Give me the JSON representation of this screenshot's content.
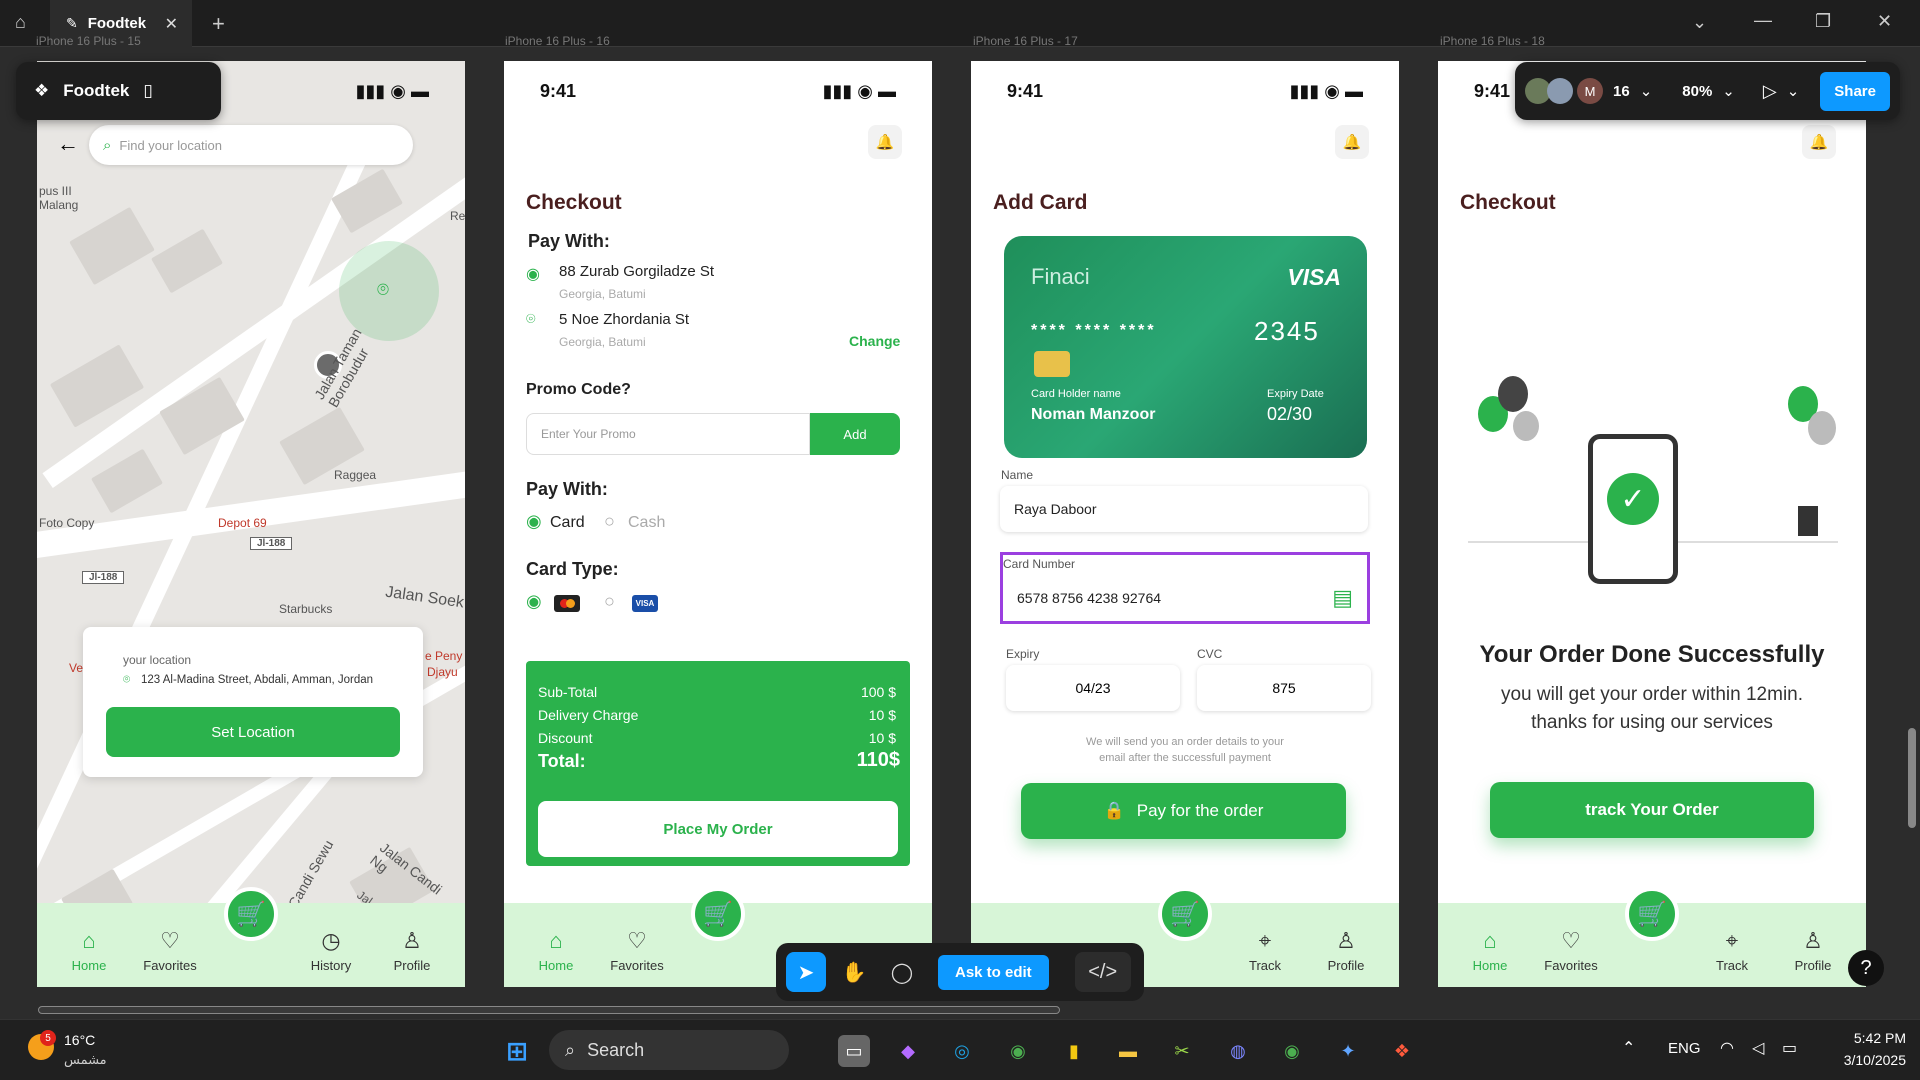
{
  "app": {
    "tab_title": "Foodtek",
    "file_name": "Foodtek"
  },
  "toolbar": {
    "zoom": "80%",
    "collaborators_count": "16",
    "avatar_letter": "M",
    "share_label": "Share",
    "ask_to_edit": "Ask to edit"
  },
  "frame_labels": [
    "iPhone 16 Plus - 15",
    "iPhone 16 Plus - 16",
    "iPhone 16 Plus - 17",
    "iPhone 16 Plus - 18"
  ],
  "status_time": "9:41",
  "nav": {
    "home": "Home",
    "favorites": "Favorites",
    "history": "History",
    "profile": "Profile",
    "track": "Track"
  },
  "screen1": {
    "search_placeholder": "Find your location",
    "map_labels": [
      "pus III Malang",
      "Re",
      "Raggea",
      "Depot 69",
      "Foto Copy",
      "Jl-188",
      "Jl-188",
      "Starbucks",
      "Jalan Soek",
      "Jalan Taman Borobudur",
      "Jalan Candi Sewu",
      "Jalan Candi Ng",
      "e Peny",
      "Djayu",
      "Ve",
      "Jal"
    ],
    "your_location_label": "your location",
    "address": "123 Al-Madina Street, Abdali, Amman, Jordan",
    "set_location": "Set Location"
  },
  "screen2": {
    "title": "Checkout",
    "pay_with": "Pay With:",
    "addresses": [
      {
        "street": "88 Zurab Gorgiladze St",
        "city": "Georgia, Batumi"
      },
      {
        "street": "5 Noe Zhordania St",
        "city": "Georgia, Batumi"
      }
    ],
    "change": "Change",
    "promo_label": "Promo Code?",
    "promo_placeholder": "Enter Your Promo",
    "add": "Add",
    "pay_with2": "Pay With:",
    "card": "Card",
    "cash": "Cash",
    "card_type": "Card Type:",
    "visa_badge": "VISA",
    "summary": [
      {
        "label": "Sub-Total",
        "value": "100 $"
      },
      {
        "label": "Delivery Charge",
        "value": "10 $"
      },
      {
        "label": "Discount",
        "value": "10 $"
      }
    ],
    "total_label": "Total:",
    "total_value": "110$",
    "place_order": "Place My Order"
  },
  "screen3": {
    "title": "Add Card",
    "card_brand": "Finaci",
    "card_network": "VISA",
    "card_masked": "**** **** ****",
    "card_last": "2345",
    "holder_label": "Card Holder name",
    "holder_name": "Noman Manzoor",
    "expiry_label": "Expiry Date",
    "expiry_value": "02/30",
    "name_label": "Name",
    "name_value": "Raya Daboor",
    "cardnum_label": "Card Number",
    "cardnum_value": "6578 8756 4238 92764",
    "exp_label": "Expiry",
    "exp_value": "04/23",
    "cvc_label": "CVC",
    "cvc_value": "875",
    "note": "We will send you an order details to your email after the successfull payment",
    "pay_button": "Pay for the order"
  },
  "screen4": {
    "title": "Checkout",
    "success_title": "Your Order Done Successfully",
    "success_msg": "you will get your order within 12min. thanks for using our services",
    "track_button": "track Your Order"
  },
  "taskbar": {
    "weather_temp": "16°C",
    "weather_desc": "مشمس",
    "weather_badge": "5",
    "search": "Search",
    "lang": "ENG",
    "time": "5:42 PM",
    "date": "3/10/2025"
  },
  "colors": {
    "brand_green": "#2bb24c",
    "figma_blue": "#0d99ff",
    "dark_maroon": "#4a1f1f"
  }
}
